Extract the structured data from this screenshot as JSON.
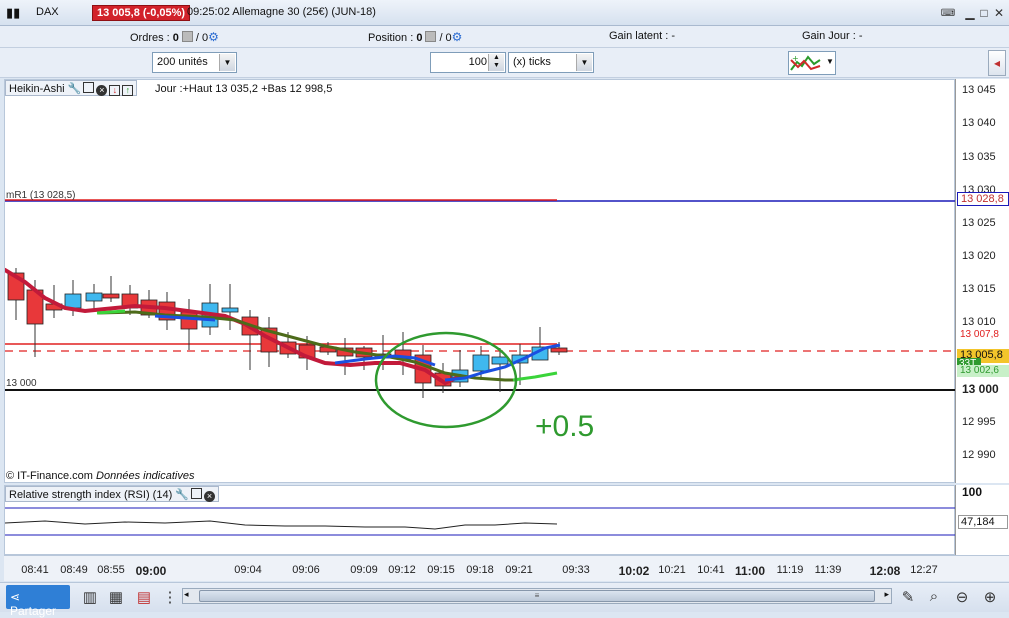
{
  "titlebar": {
    "symbol": "DAX",
    "price_change": "13 005,8 (-0,05%)",
    "title": "09:25:02 Allemagne 30 (25€) (JUN-18)"
  },
  "infobar": {
    "orders_label": "Ordres :",
    "orders_value": "0",
    "orders_sep": "/ 0",
    "position_label": "Position :",
    "position_value": "0",
    "position_sep": "/ 0",
    "gain_latent": "Gain latent :  -",
    "gain_jour": "Gain Jour :  -"
  },
  "toolbar": {
    "units_select": "200 unités",
    "quantity_value": "100",
    "ticks_select": "(x) ticks"
  },
  "chart": {
    "indicator_name": "Heikin-Ashi",
    "ohlc_text": "Jour :+Haut 13 035,2 +Bas 12 998,5",
    "r1_label": "mR1 (13 028,5)",
    "level_13000_label": "13 000",
    "source_text": "© IT-Finance.com",
    "source_note": "Données indicatives",
    "annotation": "+0.5",
    "colors": {
      "up": "#3fb8ef",
      "down": "#e8383a",
      "ma_fast": "#c21a3a",
      "ma_blue": "#1a4fe0",
      "ma_green": "#3ad43a",
      "ma_olive": "#4d6b1a",
      "r1_line": "#1a1ab8",
      "red_line": "#e02020"
    }
  },
  "yaxis": {
    "ticks": [
      "13 045",
      "13 040",
      "13 035",
      "13 030",
      "13 025",
      "13 020",
      "13 015",
      "13 010",
      "13 000",
      "12 995",
      "12 990"
    ],
    "r1_badge": "13 028,8",
    "red_badge": "13 007,8",
    "price_badge": "13 005,8",
    "timer_badge": "33T",
    "green_badge": "13 002,6"
  },
  "rsi": {
    "title": "Relative strength index (RSI) (14)",
    "top_tick": "100",
    "value": "47,184"
  },
  "xaxis": {
    "ticks": [
      "08:41",
      "08:49",
      "08:55",
      "09:00",
      "09:04",
      "09:06",
      "09:09",
      "09:12",
      "09:15",
      "09:18",
      "09:21",
      "09:33",
      "10:02",
      "10:21",
      "10:41",
      "11:00",
      "11:19",
      "11:39",
      "12:08",
      "12:27"
    ]
  },
  "bottombar": {
    "share_label": "Partager"
  }
}
